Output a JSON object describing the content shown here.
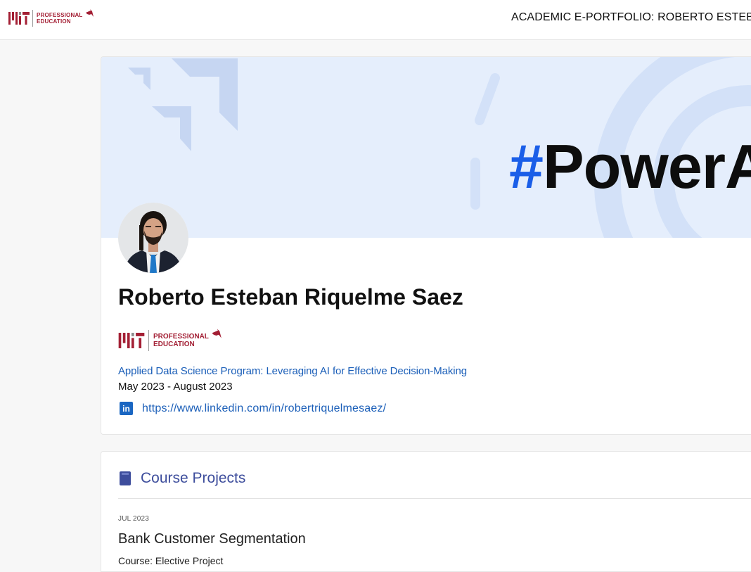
{
  "header": {
    "logo_text_line1": "PROFESSIONAL",
    "logo_text_line2": "EDUCATION",
    "title": "ACADEMIC E-PORTFOLIO: ROBERTO ESTEBAN"
  },
  "banner": {
    "hashtag_symbol": "#",
    "hashtag_text": "PowerAI"
  },
  "profile": {
    "name": "Roberto Esteban Riquelme Saez",
    "institution_line1": "PROFESSIONAL",
    "institution_line2": "EDUCATION",
    "program": "Applied Data Science Program: Leveraging AI for Effective Decision-Making",
    "dates": "May 2023 - August 2023",
    "linkedin_icon": "in",
    "linkedin_url": "https://www.linkedin.com/in/robertriquelmesaez/"
  },
  "projects": {
    "section_title": "Course Projects",
    "items": [
      {
        "date": "JUL 2023",
        "title": "Bank Customer Segmentation",
        "course": "Course: Elective Project"
      }
    ]
  },
  "colors": {
    "mit_red": "#a31f34",
    "link_blue": "#1a5eb8",
    "section_blue": "#3d4d9c",
    "banner_bg": "#e5eefc",
    "hash_blue": "#1a5ee8"
  }
}
